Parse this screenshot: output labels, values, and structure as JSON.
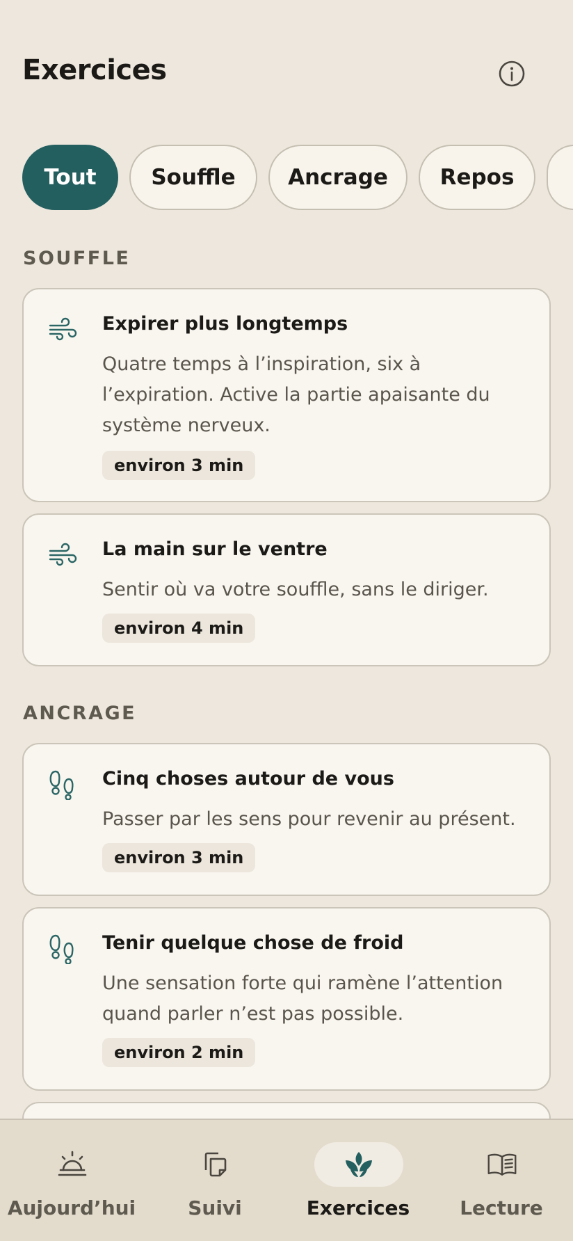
{
  "header": {
    "title": "Exercices",
    "info_icon": "info-icon"
  },
  "filters": [
    "Tout",
    "Souffle",
    "Ancrage",
    "Repos"
  ],
  "active_filter": "Tout",
  "sections": [
    {
      "title": "SOUFFLE",
      "cards": [
        {
          "icon": "wind-icon",
          "title": "Expirer plus longtemps",
          "description": "Quatre temps à l’inspiration, six à l’expiration. Active la partie apaisante du système nerveux.",
          "duration": "environ 3 min"
        },
        {
          "icon": "wind-icon",
          "title": "La main sur le ventre",
          "description": "Sentir où va votre souffle, sans le diriger.",
          "duration": "environ 4 min"
        }
      ]
    },
    {
      "title": "ANCRAGE",
      "cards": [
        {
          "icon": "footprints-icon",
          "title": "Cinq choses autour de vous",
          "description": "Passer par les sens pour revenir au présent.",
          "duration": "environ 3 min"
        },
        {
          "icon": "footprints-icon",
          "title": "Tenir quelque chose de froid",
          "description": "Une sensation forte qui ramène l’attention quand parler n’est pas possible.",
          "duration": "environ 2 min"
        }
      ]
    }
  ],
  "nav": [
    {
      "label": "Aujourd’hui",
      "icon": "sunrise-icon"
    },
    {
      "label": "Suivi",
      "icon": "copy-icon"
    },
    {
      "label": "Exercices",
      "icon": "leaf-icon",
      "active": true
    },
    {
      "label": "Lecture",
      "icon": "book-icon"
    }
  ],
  "colors": {
    "background": "#ede7dd",
    "accent": "#245f60",
    "card": "#f9f6f0",
    "nav_background": "#e3dccd"
  }
}
